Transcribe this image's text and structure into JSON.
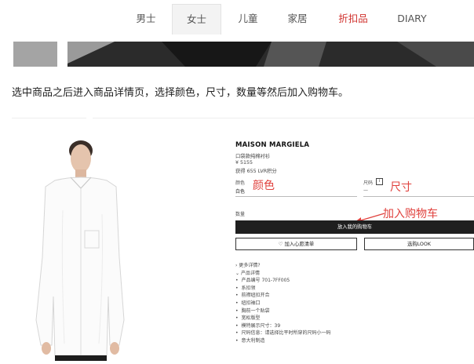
{
  "nav": {
    "tabs": [
      {
        "label": "男士"
      },
      {
        "label": "女士",
        "active": true
      },
      {
        "label": "儿童"
      },
      {
        "label": "家居"
      },
      {
        "label": "折扣品",
        "color": "#d0312d"
      },
      {
        "label": "DIARY"
      }
    ]
  },
  "instruction": "选中商品之后进入商品详情页，选择颜色，尺寸，数量等然后加入购物车。",
  "product": {
    "brand": "MAISON MARGIELA",
    "name": "口袋款纯棉衬衫",
    "price": "¥ 5155",
    "points": "获得 655 LVR积分",
    "color_label": "颜色",
    "color_value": "白色",
    "size_label": "尺码",
    "size_value": "—",
    "quantity_label": "数量",
    "add_to_cart": "放入我的购物车",
    "wishlist": "加入心愿清单",
    "shop_look": "选购LOOK",
    "more_details": "更多详情?",
    "details_title": "产品详情",
    "details": [
      "产品编号 701-7FF005",
      "系扣领",
      "前襟纽扣开合",
      "纽扣袖口",
      "胸前一个贴袋",
      "宽松版型",
      "模特展示尺寸：39",
      "尺码信息：请选择比平时所穿的尺码小一码",
      "意大利制造"
    ]
  },
  "annotations": {
    "color": "颜色",
    "size": "尺寸",
    "add_cart": "加入购物车"
  },
  "colors": {
    "annotation": "#e0413d",
    "sale": "#d0312d",
    "button_dark": "#1f1f1f"
  }
}
